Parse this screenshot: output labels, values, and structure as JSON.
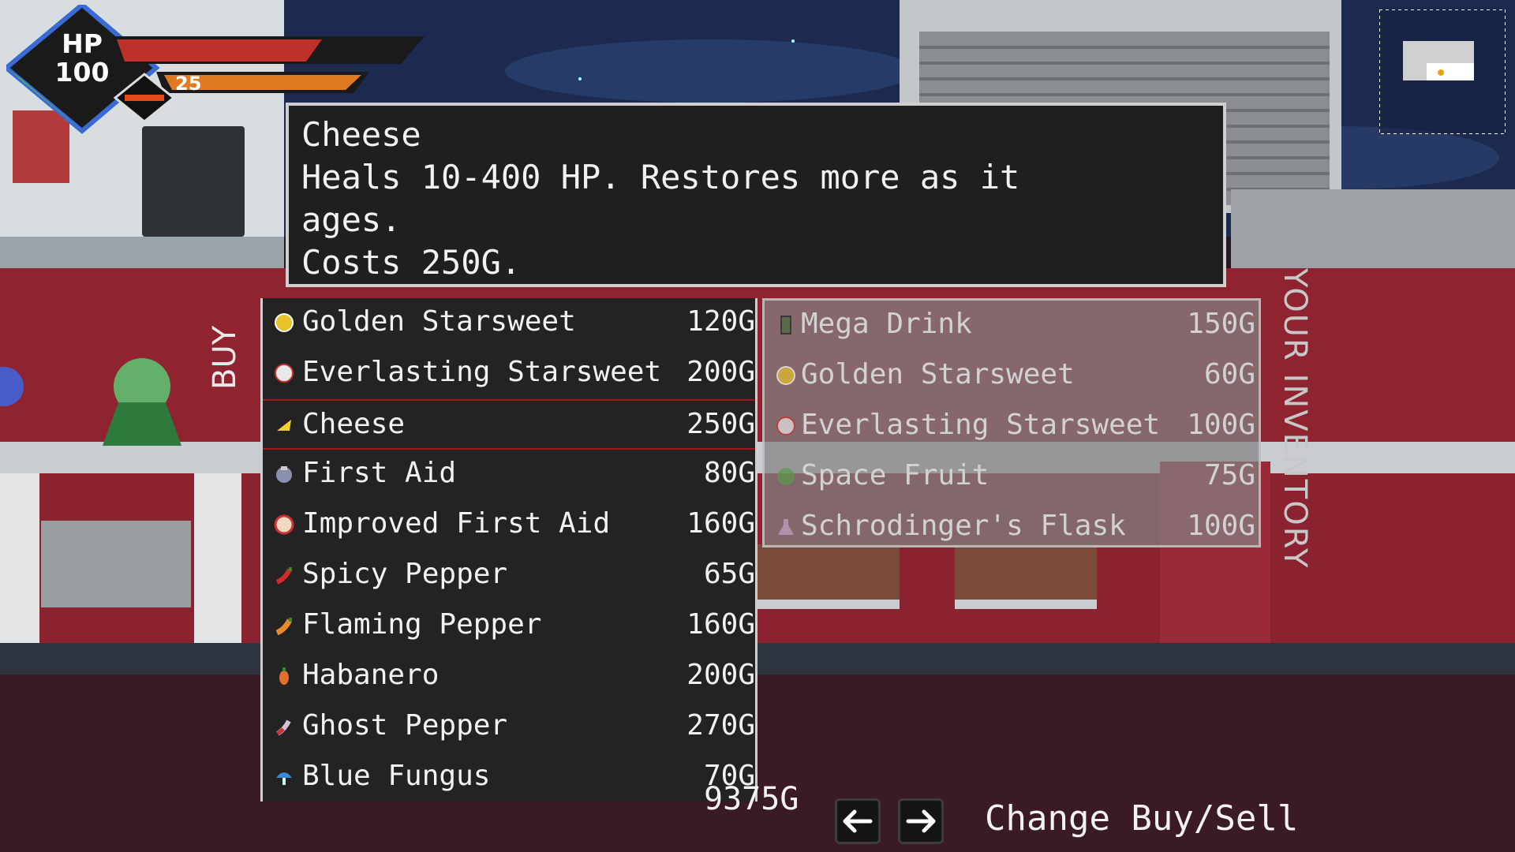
{
  "hud": {
    "hp_label": "HP",
    "hp_value": "100",
    "ammo_value": "25",
    "hp_fill": 0.72,
    "ammo_fill": 0.85
  },
  "description": {
    "text": "Cheese\nHeals 10-400 HP. Restores more as it\nages.\nCosts 250G."
  },
  "buy_panel": {
    "label": "BUY",
    "items": [
      {
        "name": "Golden Starsweet",
        "price": "120G",
        "icon": "golden-starsweet-icon"
      },
      {
        "name": "Everlasting Starsweet",
        "price": "200G",
        "icon": "everlasting-starsweet-icon"
      },
      {
        "name": "Cheese",
        "price": "250G",
        "icon": "cheese-icon",
        "selected": true
      },
      {
        "name": "First Aid",
        "price": "80G",
        "icon": "first-aid-icon"
      },
      {
        "name": "Improved First Aid",
        "price": "160G",
        "icon": "improved-first-aid-icon"
      },
      {
        "name": "Spicy Pepper",
        "price": "65G",
        "icon": "spicy-pepper-icon"
      },
      {
        "name": "Flaming Pepper",
        "price": "160G",
        "icon": "flaming-pepper-icon"
      },
      {
        "name": "Habanero",
        "price": "200G",
        "icon": "habanero-icon"
      },
      {
        "name": "Ghost Pepper",
        "price": "270G",
        "icon": "ghost-pepper-icon"
      },
      {
        "name": "Blue Fungus",
        "price": "70G",
        "icon": "blue-fungus-icon"
      }
    ]
  },
  "inventory_panel": {
    "label": "YOUR INVENTORY",
    "items": [
      {
        "name": "Mega Drink",
        "price": "150G",
        "icon": "mega-drink-icon"
      },
      {
        "name": "Golden Starsweet",
        "price": "60G",
        "icon": "golden-starsweet-icon"
      },
      {
        "name": "Everlasting Starsweet",
        "price": "100G",
        "icon": "everlasting-starsweet-icon"
      },
      {
        "name": "Space Fruit",
        "price": "75G",
        "icon": "space-fruit-icon"
      },
      {
        "name": "Schrodinger's Flask",
        "price": "100G",
        "icon": "schrodingers-flask-icon"
      }
    ]
  },
  "footer": {
    "gold": "9375G",
    "left_arrow_icon": "arrow-left-icon",
    "right_arrow_icon": "arrow-right-icon",
    "change_label": "Change Buy/Sell"
  },
  "colors": {
    "panel_bg": "#232323",
    "selected_border": "#a11a1a",
    "hp_bar": "#c0302a",
    "ammo_bar": "#e07a22"
  }
}
